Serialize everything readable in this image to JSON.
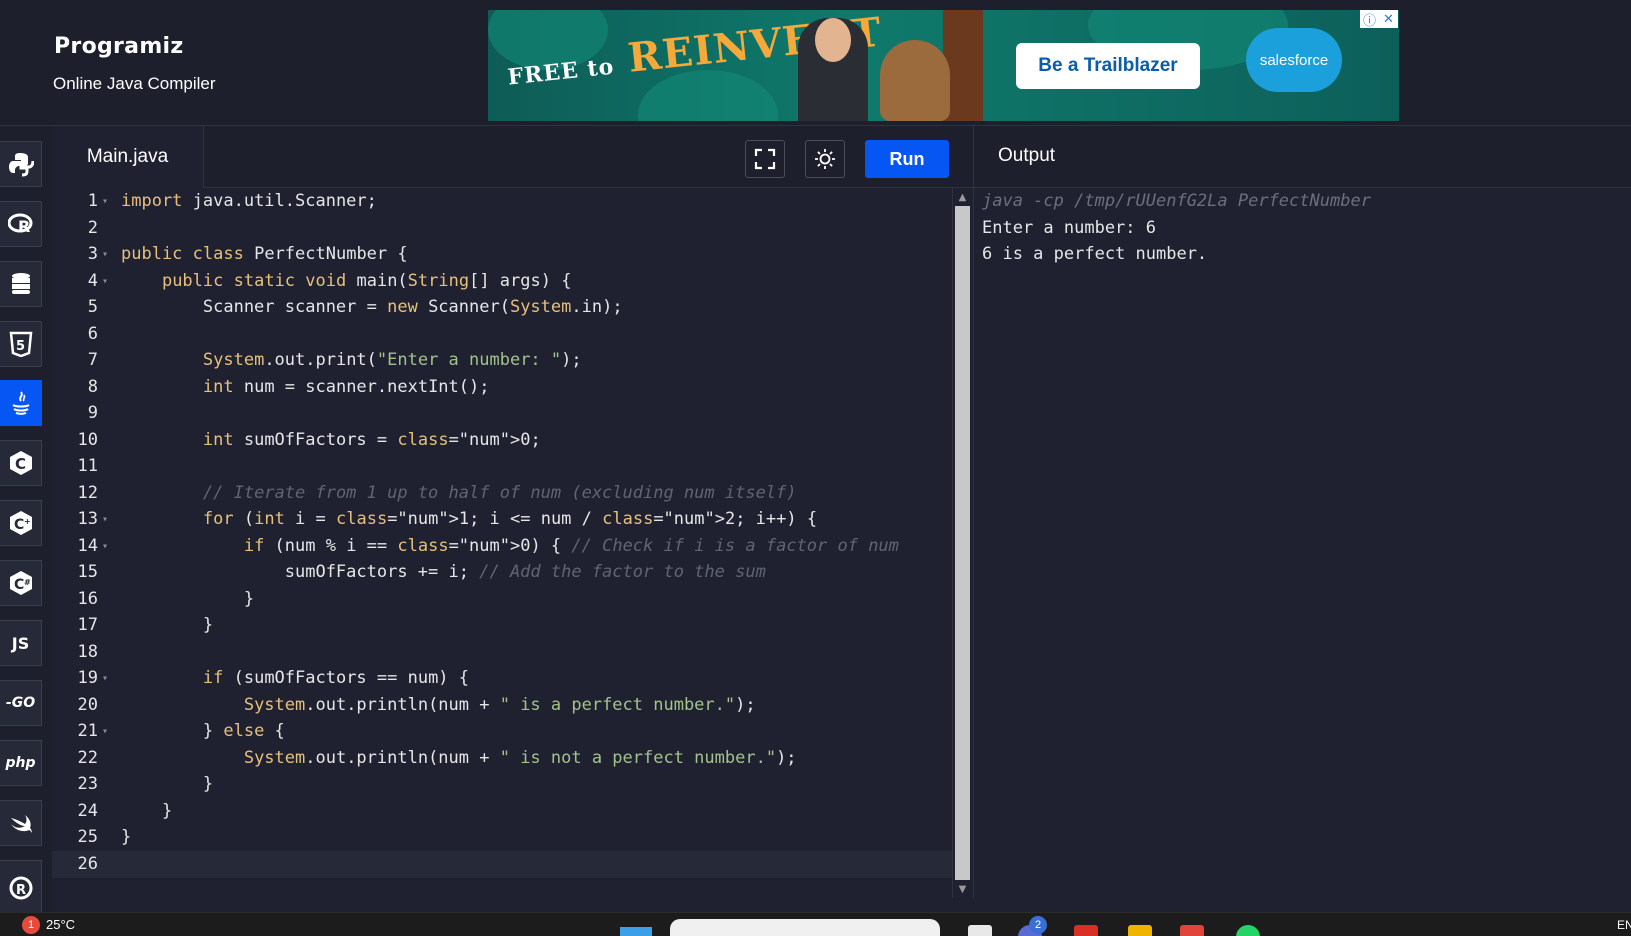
{
  "header": {
    "logo": "Programiz",
    "subtitle": "Online Java Compiler"
  },
  "ad": {
    "headline_small": "FREE to",
    "headline_big": "REINVENT",
    "button": "Be a Trailblazer",
    "brand": "salesforce",
    "info_icon": "ⓘ",
    "close_icon": "✕"
  },
  "sidebar": {
    "languages": [
      {
        "name": "python",
        "label": ""
      },
      {
        "name": "r",
        "label": "R"
      },
      {
        "name": "sql",
        "label": ""
      },
      {
        "name": "html",
        "label": "5"
      },
      {
        "name": "java",
        "label": "♨",
        "active": true
      },
      {
        "name": "c",
        "label": "C"
      },
      {
        "name": "cpp",
        "label": "C"
      },
      {
        "name": "csharp",
        "label": "C"
      },
      {
        "name": "javascript",
        "label": "JS"
      },
      {
        "name": "go",
        "label": "-GO"
      },
      {
        "name": "php",
        "label": "php"
      },
      {
        "name": "swift",
        "label": ""
      },
      {
        "name": "rust",
        "label": "R"
      }
    ]
  },
  "editor": {
    "file_tab": "Main.java",
    "run_label": "Run",
    "lines": [
      "import java.util.Scanner;",
      "",
      "public class PerfectNumber {",
      "    public static void main(String[] args) {",
      "        Scanner scanner = new Scanner(System.in);",
      "",
      "        System.out.print(\"Enter a number: \");",
      "        int num = scanner.nextInt();",
      "",
      "        int sumOfFactors = 0;",
      "",
      "        // Iterate from 1 up to half of num (excluding num itself)",
      "        for (int i = 1; i <= num / 2; i++) {",
      "            if (num % i == 0) { // Check if i is a factor of num",
      "                sumOfFactors += i; // Add the factor to the sum",
      "            }",
      "        }",
      "",
      "        if (sumOfFactors == num) {",
      "            System.out.println(num + \" is a perfect number.\");",
      "        } else {",
      "            System.out.println(num + \" is not a perfect number.\");",
      "        }",
      "    }",
      "}",
      ""
    ],
    "fold_lines": [
      1,
      3,
      4,
      13,
      14,
      19,
      21
    ]
  },
  "output": {
    "title": "Output",
    "lines": [
      "java -cp /tmp/rUUenfG2La PerfectNumber",
      "Enter a number: 6",
      "6 is a perfect number."
    ]
  },
  "taskbar": {
    "weather_badge": "1",
    "temperature": "25°C",
    "app_badge": "2",
    "tray_lang": "EN"
  },
  "colors": {
    "accent": "#0556f3",
    "background": "#1f2130",
    "header": "#1d1f2c"
  }
}
